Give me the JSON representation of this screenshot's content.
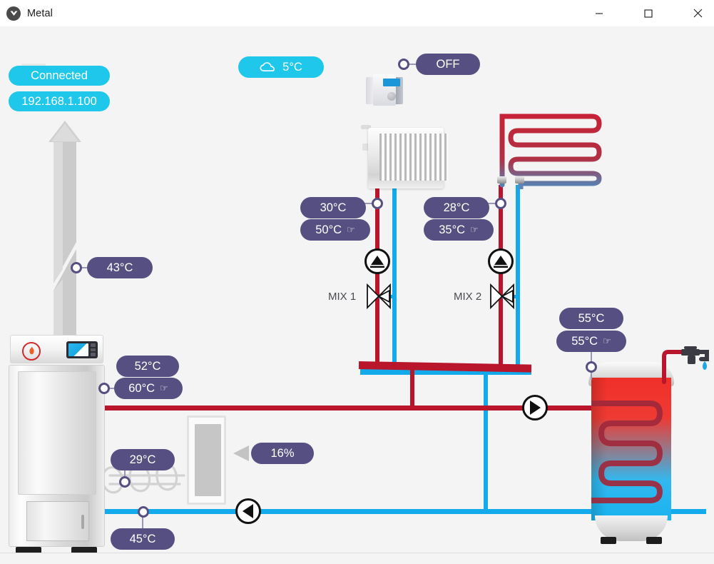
{
  "window": {
    "title": "Metal",
    "icon": "app-logo-icon",
    "controls": {
      "minimize": "minimize-icon",
      "maximize": "maximize-icon",
      "close": "close-icon"
    }
  },
  "colors": {
    "badge_cyan": "#1fc8ea",
    "badge_purple": "#565082",
    "pipe_hot": "#b9162c",
    "pipe_cold": "#12aaea",
    "canvas_bg": "#f4f4f4"
  },
  "status": {
    "connection_label": "Connected",
    "ip_address": "192.168.1.100"
  },
  "outdoor": {
    "icon": "cloud-icon",
    "temperature": "5°C"
  },
  "thermostat": {
    "device_icon": "thermostat-device-icon",
    "state": "OFF"
  },
  "circuits": [
    {
      "id": "mix1",
      "name": "MIX 1",
      "label": "MIX 1",
      "current_temp": "30°C",
      "setpoint": "50°C",
      "setpoint_editable_icon": "hand-pointer-icon",
      "emitter": "radiator-icon",
      "pump_icon": "pump-icon",
      "valve_icon": "mixing-valve-icon"
    },
    {
      "id": "mix2",
      "name": "MIX 2",
      "label": "MIX 2",
      "current_temp": "28°C",
      "setpoint": "35°C",
      "setpoint_editable_icon": "hand-pointer-icon",
      "emitter": "floor-heating-coil-icon",
      "pump_icon": "pump-icon",
      "valve_icon": "mixing-valve-icon"
    }
  ],
  "boiler": {
    "flue_temp": "43°C",
    "current_temp": "52°C",
    "setpoint": "60°C",
    "setpoint_editable_icon": "hand-pointer-icon",
    "flame_icon": "flame-icon",
    "display_icon": "boiler-display-icon",
    "chimney_icon": "chimney-icon"
  },
  "feeder": {
    "exchanger_temp": "29°C",
    "return_temp": "45°C",
    "fan_power": "16%",
    "fan_icon": "fan-arrow-icon"
  },
  "tank": {
    "current_temp": "55°C",
    "setpoint": "55°C",
    "setpoint_editable_icon": "hand-pointer-icon",
    "faucet_icon": "faucet-icon",
    "droplet_icon": "water-droplet-icon"
  },
  "pumps": {
    "main_hot_icon": "pump-right-icon",
    "main_cold_icon": "pump-left-icon"
  }
}
